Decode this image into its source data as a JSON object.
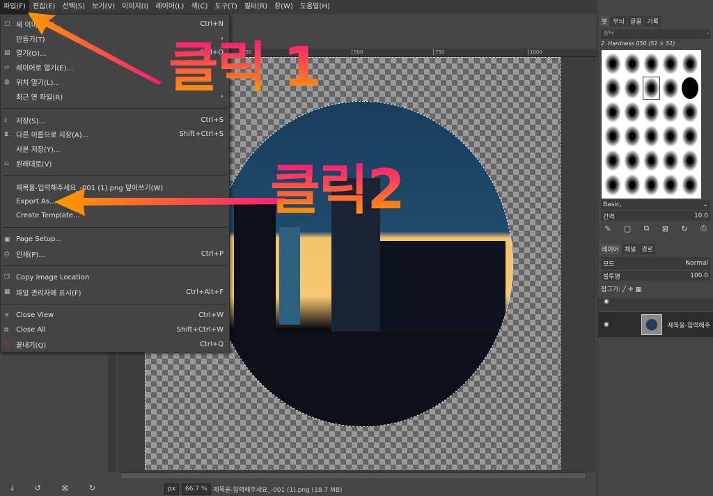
{
  "menubar": [
    "파일(F)",
    "편집(E)",
    "선택(S)",
    "보기(V)",
    "이미지(I)",
    "레이어(L)",
    "색(C)",
    "도구(T)",
    "필터(R)",
    "창(W)",
    "도움말(H)"
  ],
  "file_menu": [
    [
      {
        "label": "새 이미지(N)...",
        "shortcut": "Ctrl+N",
        "icon": "new-image-icon"
      },
      {
        "label": "만들기(T)",
        "shortcut": "›",
        "icon": ""
      },
      {
        "label": "열기(O)...",
        "shortcut": "Ctrl+O",
        "icon": "open-icon"
      },
      {
        "label": "레이어로 열기(E)...",
        "shortcut": "",
        "icon": "open-as-layers-icon"
      },
      {
        "label": "위치 열기(L)...",
        "shortcut": "",
        "icon": "open-location-icon"
      },
      {
        "label": "최근 연 파일(R)",
        "shortcut": "›",
        "icon": ""
      }
    ],
    [
      {
        "label": "저장(S)...",
        "shortcut": "Ctrl+S",
        "icon": "save-icon"
      },
      {
        "label": "다른 이름으로 저장(A)...",
        "shortcut": "Shift+Ctrl+S",
        "icon": "save-as-icon"
      },
      {
        "label": "사본 저장(Y)...",
        "shortcut": "",
        "icon": ""
      },
      {
        "label": "원래대로(V)",
        "shortcut": "",
        "icon": "revert-icon"
      }
    ],
    [
      {
        "label": "제목을-입력해주세요_-001 (1).png 덮어쓰기(W)",
        "shortcut": "",
        "icon": ""
      },
      {
        "label": "Export As...",
        "shortcut": "Shift+Ctrl+E",
        "icon": ""
      },
      {
        "label": "Create Template...",
        "shortcut": "",
        "icon": ""
      }
    ],
    [
      {
        "label": "Page Setup...",
        "shortcut": "",
        "icon": "page-setup-icon"
      },
      {
        "label": "인쇄(P)...",
        "shortcut": "Ctrl+P",
        "icon": "print-icon"
      }
    ],
    [
      {
        "label": "Copy Image Location",
        "shortcut": "",
        "icon": "copy-location-icon"
      },
      {
        "label": "파일 관리자에 표시(F)",
        "shortcut": "Ctrl+Alt+F",
        "icon": "file-manager-icon"
      }
    ],
    [
      {
        "label": "Close View",
        "shortcut": "Ctrl+W",
        "icon": "close-icon"
      },
      {
        "label": "Close All",
        "shortcut": "Shift+Ctrl+W",
        "icon": "close-all-icon"
      },
      {
        "label": "끝내기(Q)",
        "shortcut": "Ctrl+Q",
        "icon": "quit-icon"
      }
    ]
  ],
  "ruler": [
    "250",
    "500",
    "750",
    "1000"
  ],
  "annotations": {
    "click1": "클릭 1",
    "click2": "클릭2",
    "color_start": "#ff1a7a",
    "color_end": "#ff9a00"
  },
  "status": {
    "unit": "px",
    "zoom": "66.7 %",
    "file": "제목을-입력해주세요_-001 (1).png (18.7 MB)"
  },
  "right_panel": {
    "tabs": [
      "붓",
      "무늬",
      "글꼴",
      "기록"
    ],
    "filter_placeholder": "필터",
    "brush_name": "2. Hardness 050 (51 × 51)",
    "preset": "Basic,",
    "spacing_label": "간격",
    "spacing_value": "10.0",
    "layer_tabs": [
      "레이어",
      "채널",
      "경로"
    ],
    "mode_label": "모드",
    "mode_value": "Normal",
    "opacity_label": "불투명",
    "opacity_value": "100.0",
    "lock_label": "잠그기:",
    "layer_name": "제목을-입력해주"
  }
}
